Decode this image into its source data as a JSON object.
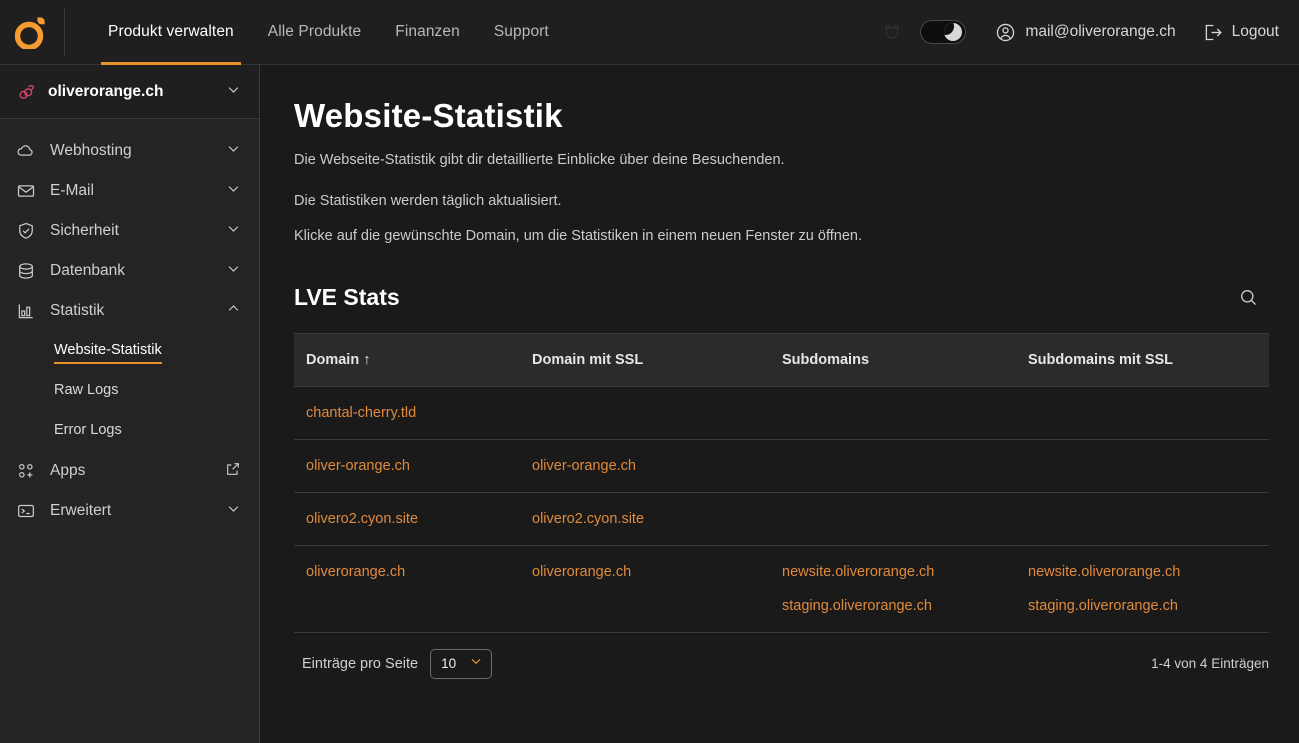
{
  "topbar": {
    "logo": "cyon-orange-logo",
    "nav": [
      {
        "label": "Produkt verwalten",
        "active": true
      },
      {
        "label": "Alle Produkte",
        "active": false
      },
      {
        "label": "Finanzen",
        "active": false
      },
      {
        "label": "Support",
        "active": false
      }
    ],
    "ghost_icon": "cow-outline-icon",
    "theme_toggle": {
      "state": "dark",
      "icon": "moon-icon"
    },
    "user_email": "mail@oliverorange.ch",
    "logout_label": "Logout"
  },
  "sidebar": {
    "domain_selector": {
      "label": "oliverorange.ch",
      "icon": "cherry-icon"
    },
    "items": [
      {
        "label": "Webhosting",
        "icon": "cloud-icon",
        "trailing": "chevron-down-icon"
      },
      {
        "label": "E-Mail",
        "icon": "envelope-icon",
        "trailing": "chevron-down-icon"
      },
      {
        "label": "Sicherheit",
        "icon": "shield-check-icon",
        "trailing": "chevron-down-icon"
      },
      {
        "label": "Datenbank",
        "icon": "database-icon",
        "trailing": "chevron-down-icon"
      },
      {
        "label": "Statistik",
        "icon": "bar-chart-icon",
        "trailing": "chevron-up-icon",
        "expanded": true
      }
    ],
    "statistik_children": [
      {
        "label": "Website-Statistik",
        "active": true
      },
      {
        "label": "Raw Logs",
        "active": false
      },
      {
        "label": "Error Logs",
        "active": false
      }
    ],
    "items_after": [
      {
        "label": "Apps",
        "icon": "apps-add-icon",
        "trailing": "external-link-icon"
      },
      {
        "label": "Erweitert",
        "icon": "terminal-icon",
        "trailing": "chevron-down-icon"
      }
    ]
  },
  "main": {
    "title": "Website-Statistik",
    "lead_1": "Die Webseite-Statistik gibt dir detaillierte Einblicke über deine Besuchenden.",
    "lead_2": "Die Statistiken werden täglich aktualisiert.",
    "lead_3": "Klicke auf die gewünschte Domain, um die Statistiken in einem neuen Fenster zu öffnen.",
    "section_title": "LVE Stats",
    "search_icon": "search-icon",
    "table": {
      "columns": [
        "Domain ↑",
        "Domain mit SSL",
        "Subdomains",
        "Subdomains mit SSL"
      ],
      "rows": [
        {
          "domain": [
            "chantal-cherry.tld"
          ],
          "domain_ssl": [],
          "subdomains": [],
          "subdomains_ssl": []
        },
        {
          "domain": [
            "oliver-orange.ch"
          ],
          "domain_ssl": [
            "oliver-orange.ch"
          ],
          "subdomains": [],
          "subdomains_ssl": []
        },
        {
          "domain": [
            "olivero2.cyon.site"
          ],
          "domain_ssl": [
            "olivero2.cyon.site"
          ],
          "subdomains": [],
          "subdomains_ssl": []
        },
        {
          "domain": [
            "oliverorange.ch"
          ],
          "domain_ssl": [
            "oliverorange.ch"
          ],
          "subdomains": [
            "newsite.oliverorange.ch",
            "staging.oliverorange.ch"
          ],
          "subdomains_ssl": [
            "newsite.oliverorange.ch",
            "staging.oliverorange.ch"
          ]
        }
      ]
    },
    "footer": {
      "per_page_label": "Einträge pro Seite",
      "per_page_value": "10",
      "count_text": "1-4 von 4 Einträgen"
    }
  },
  "colors": {
    "accent_orange": "#e8922c",
    "link_orange": "#e08a3c",
    "cherry_pink": "#d6456b",
    "sidebar_bg": "#242424",
    "main_bg": "#1a1a1a",
    "topbar_bg": "#1f1f1f"
  }
}
